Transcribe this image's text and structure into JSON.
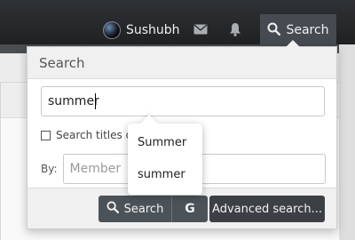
{
  "header": {
    "username": "Sushubh",
    "search_tab_label": "Search"
  },
  "icons": {
    "mail": "envelope-icon",
    "alerts": "bell-icon",
    "search": "magnifier-icon"
  },
  "dropdown": {
    "title": "Search",
    "query_value": "summer",
    "titles_only_label": "Search titles o",
    "by_label": "By:",
    "member_placeholder": "Member",
    "search_button": "Search",
    "google_button": "G",
    "advanced_button": "Advanced search..."
  },
  "suggestions": [
    "Summer",
    "summer"
  ]
}
